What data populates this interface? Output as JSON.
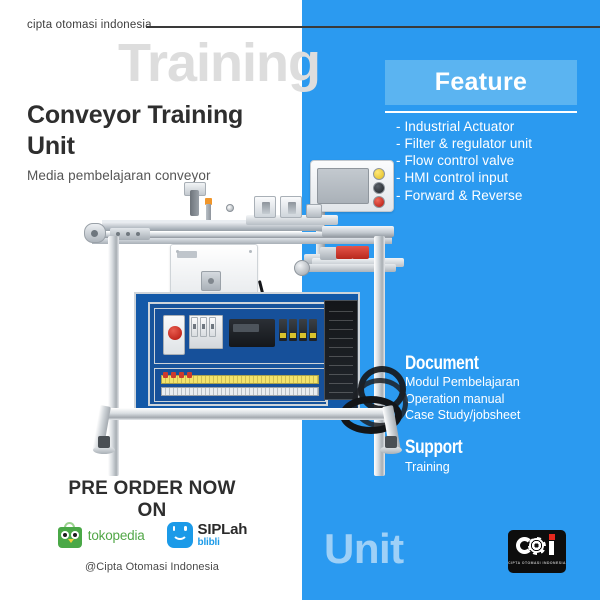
{
  "brand": {
    "tagline": "cipta otomasi indonesia",
    "watermark_top": "Training",
    "watermark_bottom": "Unit",
    "logo_mark_text": "COi",
    "logo_sub_text": "CIPTA OTOMASI INDONESIA"
  },
  "product": {
    "title": "Conveyor Training Unit",
    "subtitle": "Media pembelajaran conveyor"
  },
  "feature": {
    "heading": "Feature",
    "items": [
      "- Industrial Actuator",
      "- Filter & regulator unit",
      "- Flow control valve",
      "- HMI control input",
      "- Forward & Reverse"
    ]
  },
  "document": {
    "heading": "Document",
    "items": [
      "Modul Pembelajaran",
      "Operation manual",
      "Case Study/jobsheet"
    ]
  },
  "support": {
    "heading": "Support",
    "items": [
      "Training"
    ]
  },
  "cta": {
    "line1": "PRE ORDER NOW",
    "line2": "ON",
    "handle": "@Cipta Otomasi Indonesia",
    "stores": [
      {
        "name": "tokopedia",
        "label": "tokopedia",
        "sub": ""
      },
      {
        "name": "siplah",
        "label": "SIPLah",
        "sub": "blibli"
      }
    ]
  },
  "colors": {
    "panel_blue": "#2b9af0",
    "feature_blue": "#5bb4f1",
    "watermark_grey": "#dddddd",
    "watermark_blue": "#9ed0f7",
    "text_dark": "#2e2e2e",
    "white": "#ffffff",
    "tokopedia_green": "#4aa847",
    "siplah_blue": "#1b9ae8",
    "logo_red": "#e8281e"
  }
}
